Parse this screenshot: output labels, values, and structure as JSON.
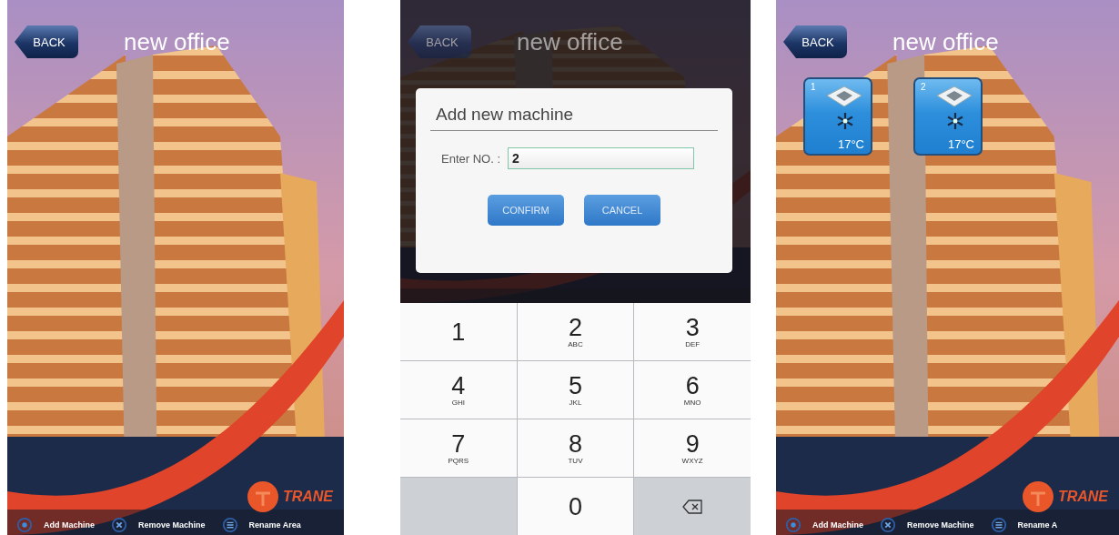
{
  "screens": [
    {
      "kind": "area",
      "back": "BACK",
      "title": "new office",
      "logo": "TRANE",
      "footer": [
        {
          "kind": "add",
          "label": "Add Machine"
        },
        {
          "kind": "remove",
          "label": "Remove Machine"
        },
        {
          "kind": "rename",
          "label": "Rename Area"
        }
      ]
    },
    {
      "kind": "dialog",
      "back": "BACK",
      "title": "new office",
      "dialog": {
        "title": "Add new machine",
        "label": "Enter NO. :",
        "value": "2",
        "buttons": [
          "CONFIRM",
          "CANCEL"
        ]
      },
      "keypad": [
        {
          "kind": "digit",
          "digit": "1"
        },
        {
          "kind": "digit",
          "digit": "2",
          "letters": "ABC"
        },
        {
          "kind": "digit",
          "digit": "3",
          "letters": "DEF"
        },
        {
          "kind": "digit",
          "digit": "4",
          "letters": "GHI"
        },
        {
          "kind": "digit",
          "digit": "5",
          "letters": "JKL"
        },
        {
          "kind": "digit",
          "digit": "6",
          "letters": "MNO"
        },
        {
          "kind": "digit",
          "digit": "7",
          "letters": "PQRS"
        },
        {
          "kind": "digit",
          "digit": "8",
          "letters": "TUV"
        },
        {
          "kind": "digit",
          "digit": "9",
          "letters": "WXYZ"
        },
        {
          "kind": "blank"
        },
        {
          "kind": "digit",
          "digit": "0"
        },
        {
          "kind": "backspace"
        }
      ]
    },
    {
      "kind": "area",
      "back": "BACK",
      "title": "new office",
      "machines": [
        {
          "number": "1",
          "temp": "17°C"
        },
        {
          "number": "2",
          "temp": "17°C"
        }
      ],
      "logo": "TRANE",
      "footer": [
        {
          "kind": "add",
          "label": "Add Machine"
        },
        {
          "kind": "remove",
          "label": "Remove Machine"
        },
        {
          "kind": "rename",
          "label": "Rename A"
        }
      ]
    }
  ]
}
